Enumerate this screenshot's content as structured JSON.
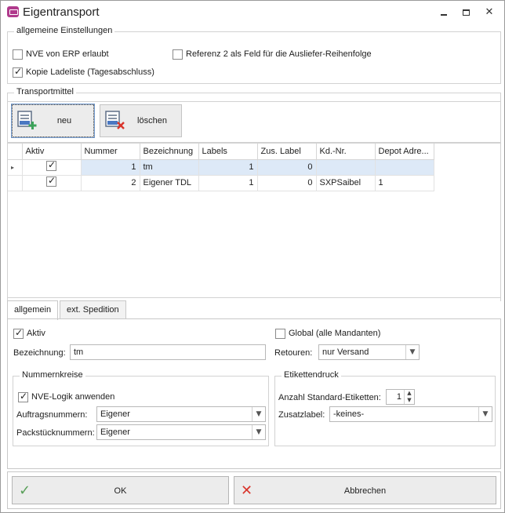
{
  "window": {
    "title": "Eigentransport"
  },
  "general": {
    "title": "allgemeine Einstellungen",
    "nve_erp_label": "NVE von ERP erlaubt",
    "nve_erp_checked": false,
    "referenz_label": "Referenz 2 als Feld für die Ausliefer-Reihenfolge",
    "referenz_checked": false,
    "kopie_label": "Kopie Ladeliste (Tagesabschluss)",
    "kopie_checked": true
  },
  "transport": {
    "title": "Transportmittel",
    "new_label": "neu",
    "delete_label": "löschen"
  },
  "grid": {
    "columns": [
      "Aktiv",
      "Nummer",
      "Bezeichnung",
      "Labels",
      "Zus. Label",
      "Kd.-Nr.",
      "Depot Adre..."
    ],
    "rows": [
      {
        "aktiv": true,
        "nummer": "1",
        "bezeichnung": "tm",
        "labels": "1",
        "zus": "0",
        "kdnr": "",
        "depot": ""
      },
      {
        "aktiv": true,
        "nummer": "2",
        "bezeichnung": "Eigener TDL",
        "labels": "1",
        "zus": "0",
        "kdnr": "SXPSaibel",
        "depot": "1"
      }
    ]
  },
  "tabs": [
    "allgemein",
    "ext. Spedition"
  ],
  "detail": {
    "aktiv_label": "Aktiv",
    "aktiv_checked": true,
    "global_label": "Global (alle Mandanten)",
    "global_checked": false,
    "bezeichnung_label": "Bezeichnung:",
    "bezeichnung_value": "tm",
    "retouren_label": "Retouren:",
    "retouren_value": "nur Versand",
    "nummernkreise": {
      "title": "Nummernkreise",
      "nve_logik_label": "NVE-Logik anwenden",
      "nve_logik_checked": true,
      "auftrag_label": "Auftragsnummern:",
      "auftrag_value": "Eigener",
      "packstueck_label": "Packstücknummern:",
      "packstueck_value": "Eigener"
    },
    "etiketten": {
      "title": "Etikettendruck",
      "anzahl_label": "Anzahl Standard-Etiketten:",
      "anzahl_value": "1",
      "zusatz_label": "Zusatzlabel:",
      "zusatz_value": "-keines-"
    }
  },
  "footer": {
    "ok_label": "OK",
    "cancel_label": "Abbrechen"
  },
  "colors": {
    "ok_icon": "#5aa05a",
    "cancel_icon": "#d9342b",
    "selected_row": "#dde9f7"
  }
}
